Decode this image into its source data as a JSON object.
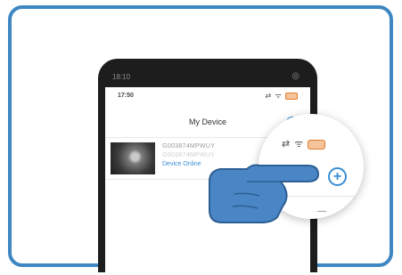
{
  "phone": {
    "outer_time": "18:10",
    "outer_status_icon": "wifi-icon"
  },
  "app": {
    "time": "17:50",
    "status_icons": "⇄ ᯤ",
    "title": "My Device",
    "add_icon": "+"
  },
  "device": {
    "name": "G003874MPWUY",
    "id": "G003874MPWUY",
    "status": "Device Online"
  },
  "magnifier": {
    "status_icons": "⇄ ᯤ",
    "add_icon": "+",
    "dash": "—"
  },
  "colors": {
    "frame": "#3f87c2",
    "accent": "#3a8ed6",
    "battery": "#e07a2b",
    "hand": "#4a86c6"
  }
}
